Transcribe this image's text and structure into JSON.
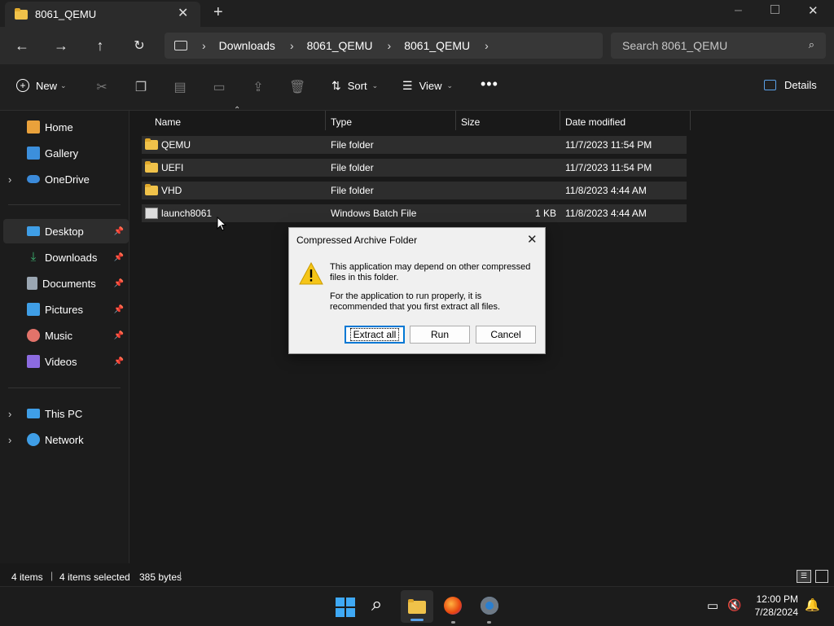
{
  "window": {
    "tab_title": "8061_QEMU",
    "new_tab_icon": "plus-icon",
    "controls": [
      "minimize-icon",
      "restore-icon",
      "close-icon"
    ]
  },
  "address": {
    "crumbs": [
      "Downloads",
      "8061_QEMU",
      "8061_QEMU"
    ],
    "search_placeholder": "Search 8061_QEMU"
  },
  "toolbar": {
    "new_label": "New",
    "sort_label": "Sort",
    "view_label": "View",
    "details_label": "Details"
  },
  "sidebar": {
    "items": [
      {
        "label": "Home",
        "icon": "home-icon",
        "color": "#e9a13b"
      },
      {
        "label": "Gallery",
        "icon": "gallery-icon",
        "color": "#3c8fdc"
      },
      {
        "label": "OneDrive",
        "icon": "onedrive-icon",
        "color": "#3b8ad9"
      },
      {
        "label": "Desktop",
        "icon": "desktop-icon",
        "color": "#3f9ee6"
      },
      {
        "label": "Downloads",
        "icon": "download-icon",
        "color": "#3cb371"
      },
      {
        "label": "Documents",
        "icon": "documents-icon",
        "color": "#9aa6b2"
      },
      {
        "label": "Pictures",
        "icon": "pictures-icon",
        "color": "#3f9ee6"
      },
      {
        "label": "Music",
        "icon": "music-icon",
        "color": "#e2736a"
      },
      {
        "label": "Videos",
        "icon": "videos-icon",
        "color": "#8c6be0"
      },
      {
        "label": "This PC",
        "icon": "pc-icon",
        "color": "#3f9ee6"
      },
      {
        "label": "Network",
        "icon": "network-icon",
        "color": "#3f9ee6"
      }
    ]
  },
  "columns": [
    "Name",
    "Type",
    "Size",
    "Date modified"
  ],
  "files": [
    {
      "name": "QEMU",
      "type": "File folder",
      "size": "",
      "date": "11/7/2023 11:54 PM"
    },
    {
      "name": "UEFI",
      "type": "File folder",
      "size": "",
      "date": "11/7/2023 11:54 PM"
    },
    {
      "name": "VHD",
      "type": "File folder",
      "size": "",
      "date": "11/8/2023 4:44 AM"
    },
    {
      "name": "launch8061",
      "type": "Windows Batch File",
      "size": "1 KB",
      "date": "11/8/2023 4:44 AM"
    }
  ],
  "dialog": {
    "title": "Compressed Archive Folder",
    "line1": "This application may depend on other compressed files in this folder.",
    "line2": "For the application to run properly, it is recommended that you first extract all files.",
    "extract_label": "Extract all",
    "run_label": "Run",
    "cancel_label": "Cancel"
  },
  "status": {
    "count": "4 items",
    "selected": "4 items selected",
    "size": "385 bytes"
  },
  "clock": {
    "time": "12:00 PM",
    "date": "7/28/2024"
  },
  "colors": {
    "accent": "#0078d4",
    "folder": "#f0c24a"
  }
}
